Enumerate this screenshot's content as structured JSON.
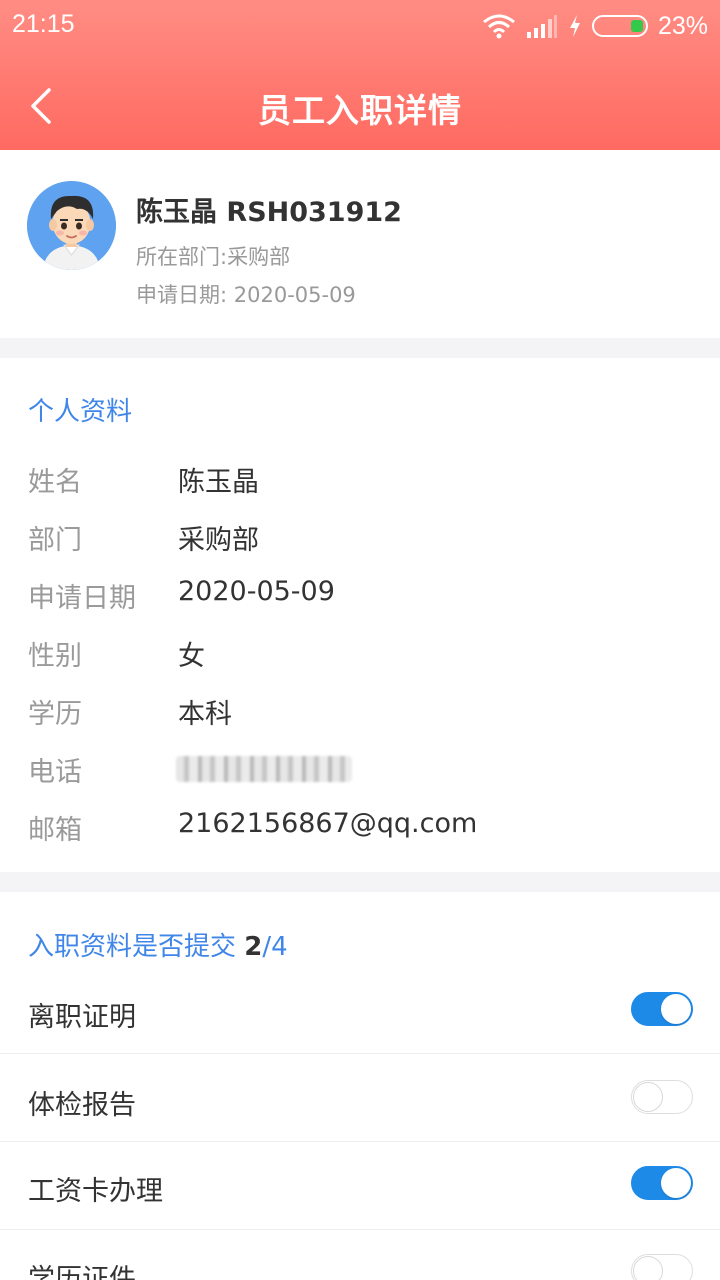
{
  "status_bar": {
    "time": "21:15",
    "battery_pct": "23%"
  },
  "header": {
    "title": "员工入职详情"
  },
  "profile": {
    "name_id": "陈玉晶 RSH031912",
    "dept_line": "所在部门:采购部",
    "date_line": "申请日期: 2020-05-09"
  },
  "personal": {
    "title": "个人资料",
    "rows": [
      {
        "label": "姓名",
        "value": "陈玉晶"
      },
      {
        "label": "部门",
        "value": "采购部"
      },
      {
        "label": "申请日期",
        "value": "2020-05-09"
      },
      {
        "label": "性别",
        "value": "女"
      },
      {
        "label": "学历",
        "value": "本科"
      },
      {
        "label": "电话",
        "value": ""
      },
      {
        "label": "邮箱",
        "value": "2162156867@qq.com"
      }
    ]
  },
  "onboarding": {
    "title": "入职资料是否提交",
    "done": "2",
    "total": "/4",
    "items": [
      {
        "label": "离职证明",
        "checked": true
      },
      {
        "label": "体检报告",
        "checked": false
      },
      {
        "label": "工资卡办理",
        "checked": true
      },
      {
        "label": "学历证件",
        "checked": false
      }
    ]
  },
  "colors": {
    "header_top": "#ff8d84",
    "header_bottom": "#ff6a61",
    "accent_blue": "#3f86e8",
    "switch_on": "#1e8ae8"
  },
  "icons": [
    "wifi-icon",
    "signal-icon",
    "charging-icon",
    "battery-icon",
    "back-arrow-icon",
    "avatar"
  ]
}
